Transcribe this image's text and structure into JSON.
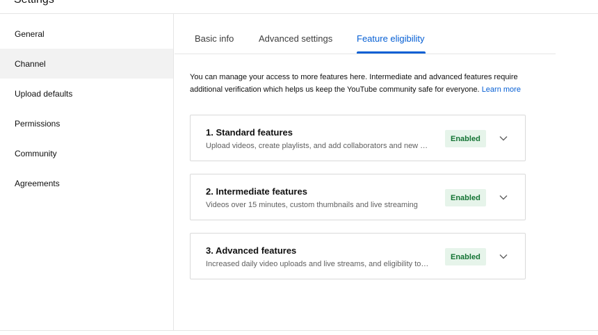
{
  "header": {
    "title": "Settings"
  },
  "sidebar": {
    "items": [
      {
        "label": "General",
        "active": false
      },
      {
        "label": "Channel",
        "active": true
      },
      {
        "label": "Upload defaults",
        "active": false
      },
      {
        "label": "Permissions",
        "active": false
      },
      {
        "label": "Community",
        "active": false
      },
      {
        "label": "Agreements",
        "active": false
      }
    ]
  },
  "tabs": [
    {
      "label": "Basic info",
      "active": false
    },
    {
      "label": "Advanced settings",
      "active": false
    },
    {
      "label": "Feature eligibility",
      "active": true
    }
  ],
  "intro": {
    "text": "You can manage your access to more features here. Intermediate and advanced features require additional verification which helps us keep the YouTube community safe for everyone.",
    "link": "Learn more"
  },
  "features": [
    {
      "title": "1. Standard features",
      "description": "Upload videos, create playlists, and add collaborators and new …",
      "status": "Enabled"
    },
    {
      "title": "2. Intermediate features",
      "description": "Videos over 15 minutes, custom thumbnails and live streaming",
      "status": "Enabled"
    },
    {
      "title": "3. Advanced features",
      "description": "Increased daily video uploads and live streams, and eligibility to…",
      "status": "Enabled"
    }
  ],
  "colors": {
    "accent": "#065fd4",
    "enabled_bg": "#e6f4ea",
    "enabled_text": "#137333"
  },
  "icons": {
    "expand": "chevron-down-icon"
  }
}
